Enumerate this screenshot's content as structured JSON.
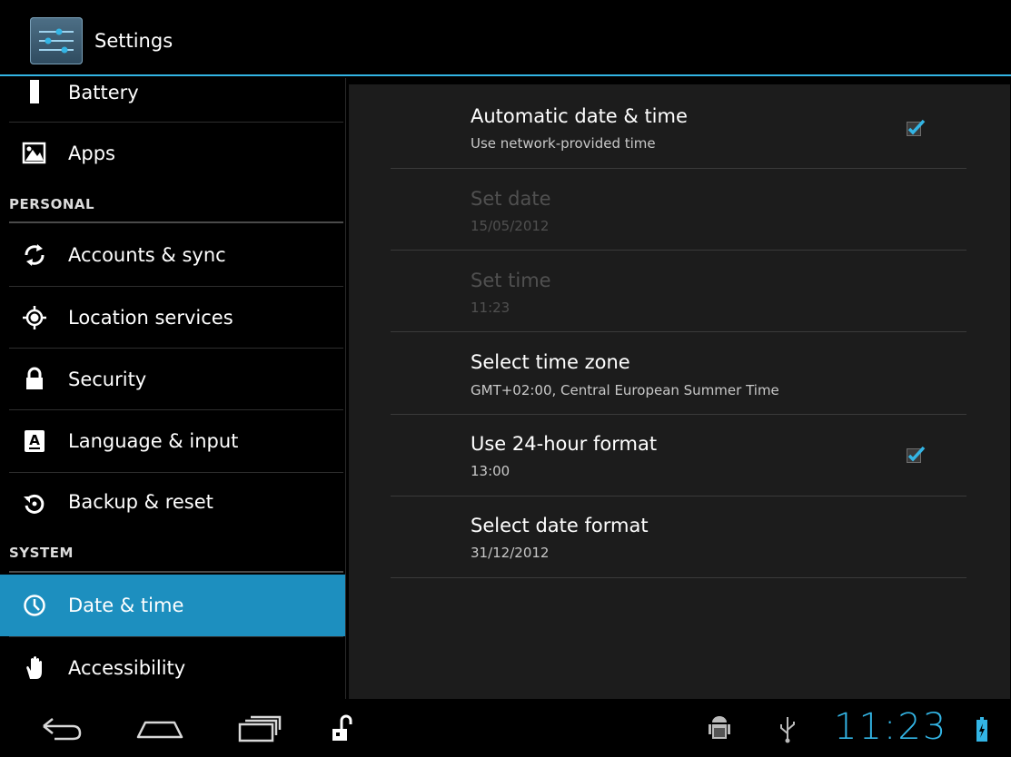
{
  "app": {
    "title": "Settings"
  },
  "sidebar": {
    "items": [
      {
        "label": "Battery",
        "icon": "battery-icon"
      },
      {
        "label": "Apps",
        "icon": "apps-icon"
      },
      {
        "label": "Accounts & sync",
        "icon": "sync-icon"
      },
      {
        "label": "Location services",
        "icon": "location-icon"
      },
      {
        "label": "Security",
        "icon": "lock-icon"
      },
      {
        "label": "Language & input",
        "icon": "language-icon"
      },
      {
        "label": "Backup & reset",
        "icon": "backup-icon"
      },
      {
        "label": "Date & time",
        "icon": "clock-icon",
        "selected": true
      },
      {
        "label": "Accessibility",
        "icon": "hand-icon"
      }
    ],
    "headers": {
      "personal": "PERSONAL",
      "system": "SYSTEM"
    }
  },
  "preferences": [
    {
      "title": "Automatic date & time",
      "summary": "Use network-provided time",
      "checked": true,
      "enabled": true
    },
    {
      "title": "Set date",
      "summary": "15/05/2012",
      "enabled": false
    },
    {
      "title": "Set time",
      "summary": "11:23",
      "enabled": false
    },
    {
      "title": "Select time zone",
      "summary": "GMT+02:00, Central European Summer Time",
      "enabled": true
    },
    {
      "title": "Use 24-hour format",
      "summary": "13:00",
      "checked": true,
      "enabled": true
    },
    {
      "title": "Select date format",
      "summary": "31/12/2012",
      "enabled": true
    }
  ],
  "statusbar": {
    "clock": "11:23"
  },
  "colors": {
    "accent": "#33b5e5",
    "selected": "#1d8fbf"
  }
}
